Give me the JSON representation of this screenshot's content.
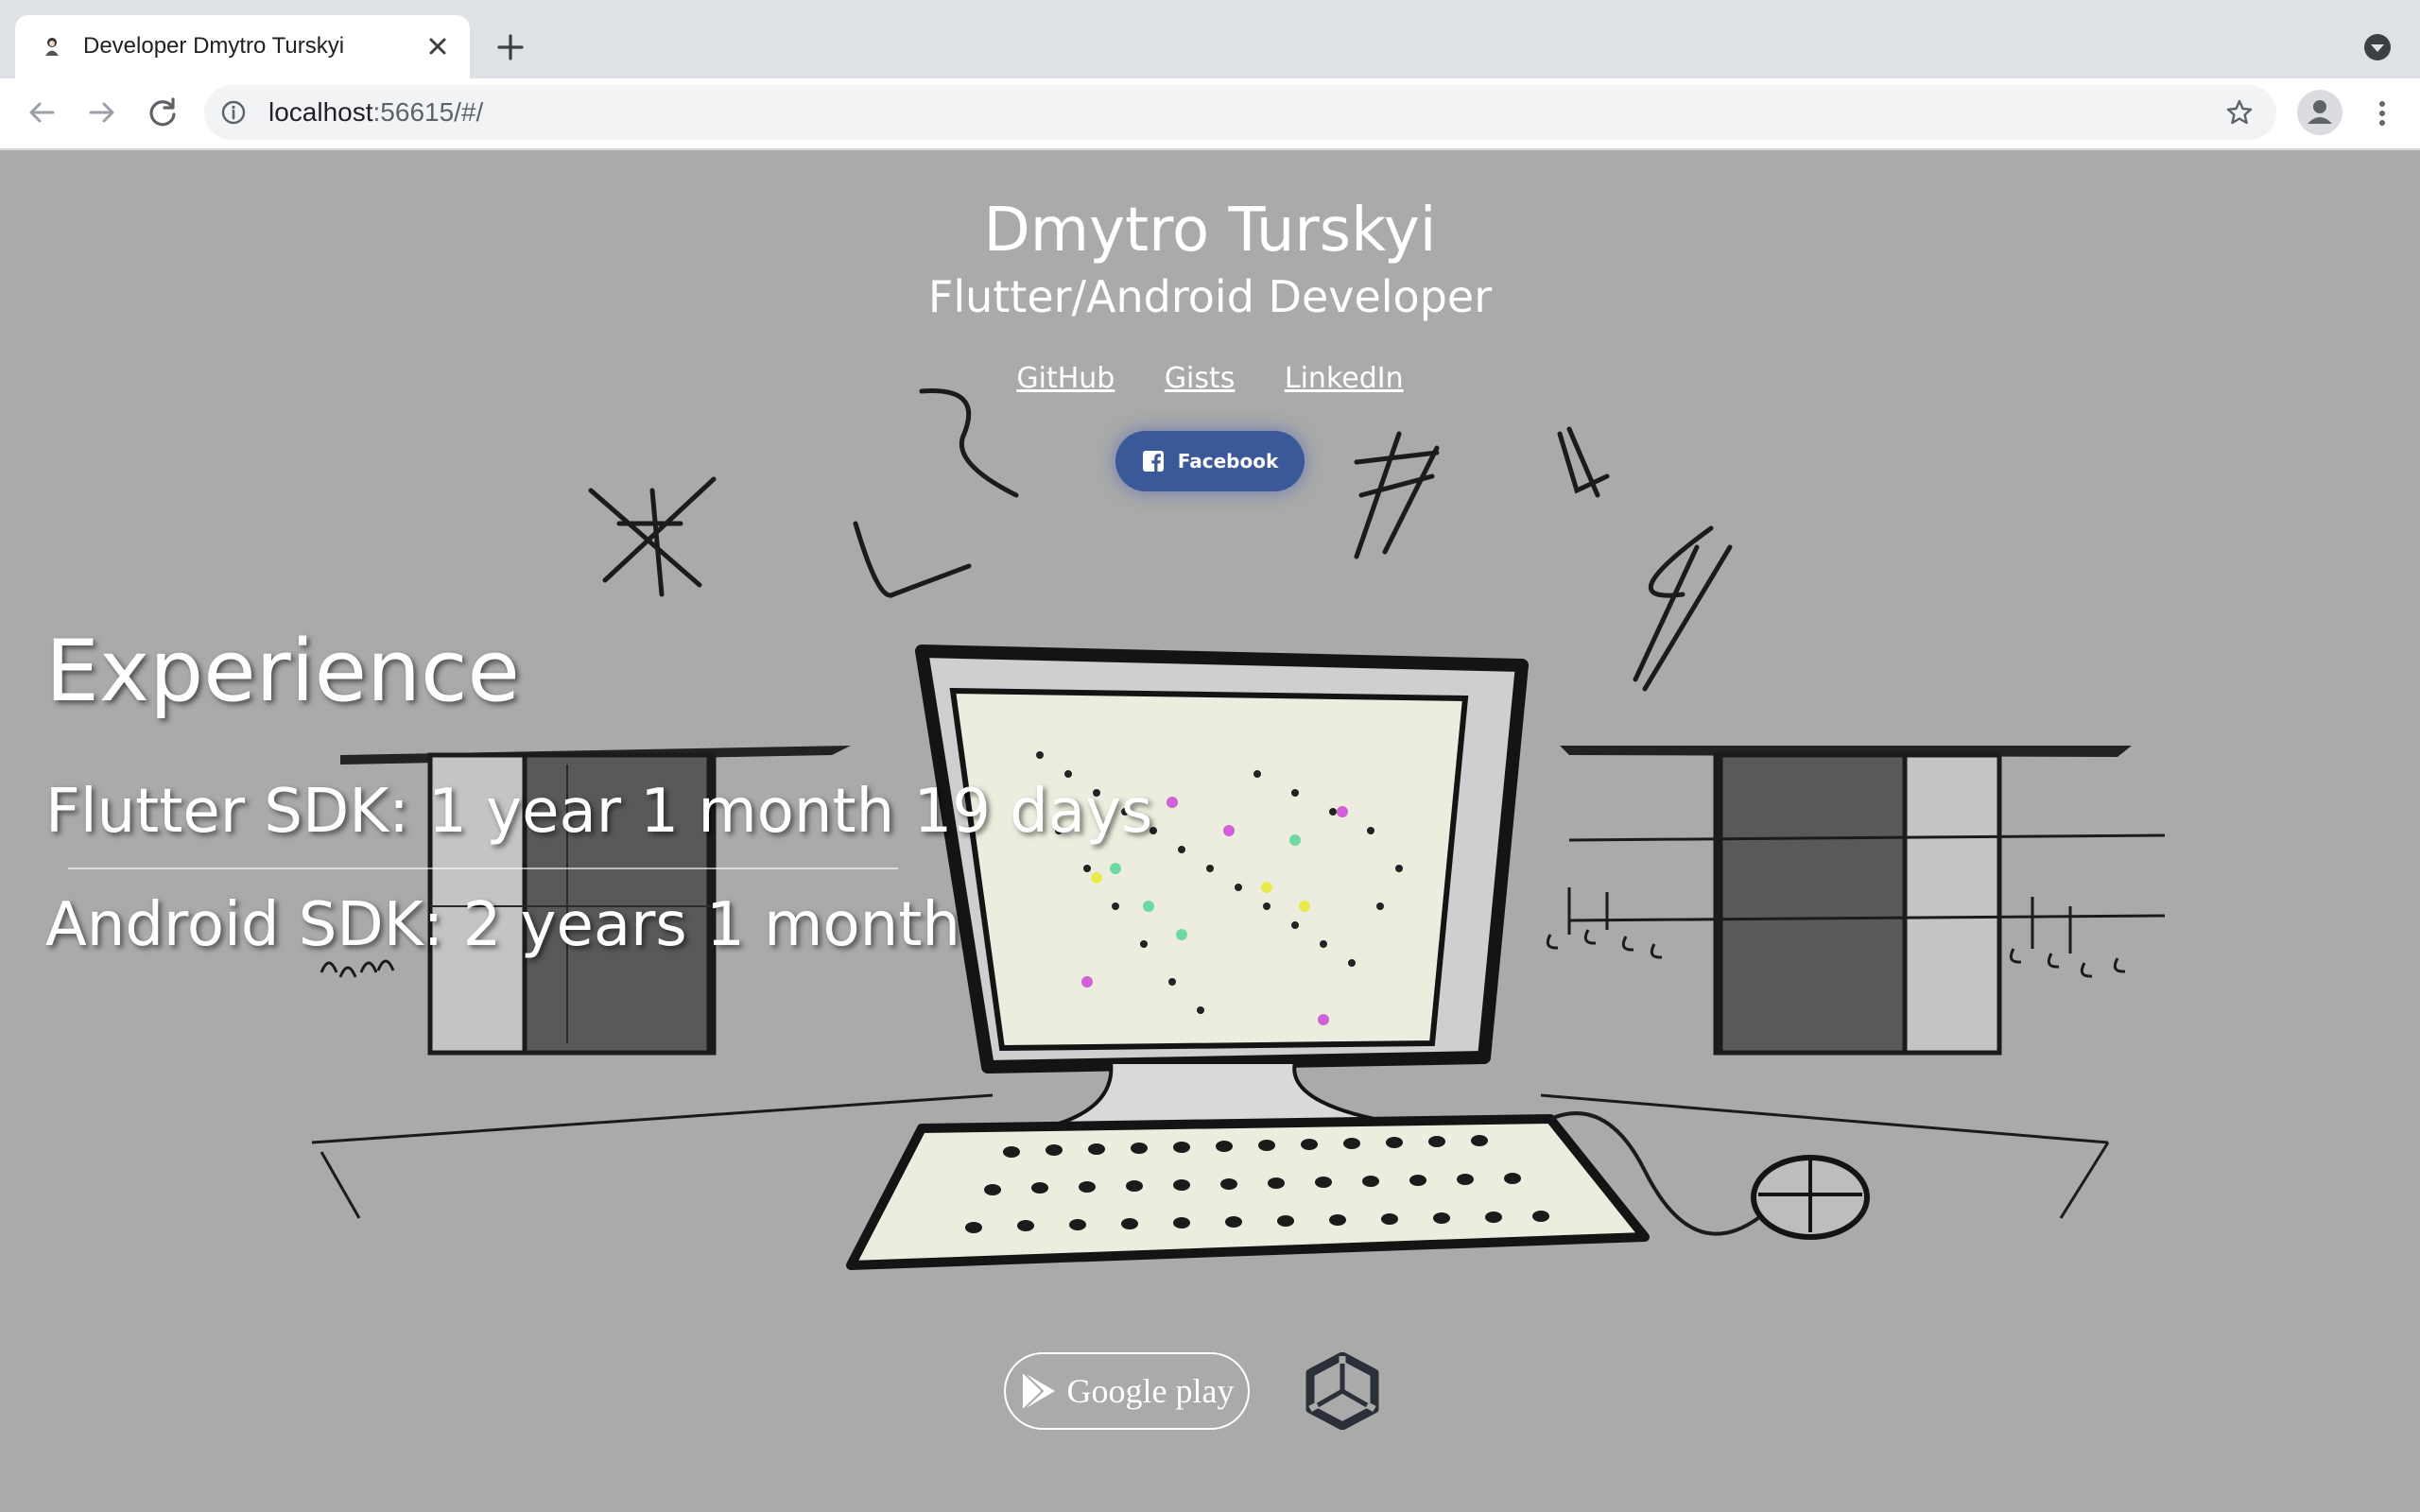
{
  "browser": {
    "tab_title": "Developer Dmytro Turskyi",
    "url_host": "localhost",
    "url_rest": ":56615/#/"
  },
  "header": {
    "name": "Dmytro Turskyi",
    "role": "Flutter/Android Developer"
  },
  "links": {
    "github": "GitHub",
    "gists": "Gists",
    "linkedin": "LinkedIn"
  },
  "facebook": {
    "label": "Facebook",
    "color": "#3b5998"
  },
  "experience": {
    "title": "Experience",
    "flutter": "Flutter SDK: 1 year 1 month 19 days",
    "android": "Android SDK: 2 years 1 month"
  },
  "stores": {
    "google_play": "Google play"
  },
  "colors": {
    "page_background": "#a9aaa9",
    "tabbar": "#dee1e6"
  },
  "icons": [
    "favicon-icon",
    "close-icon",
    "plus-icon",
    "dropdown-icon",
    "back-icon",
    "forward-icon",
    "reload-icon",
    "info-icon",
    "star-icon",
    "profile-icon",
    "more-icon",
    "facebook-icon",
    "google-play-icon",
    "unity-icon"
  ]
}
